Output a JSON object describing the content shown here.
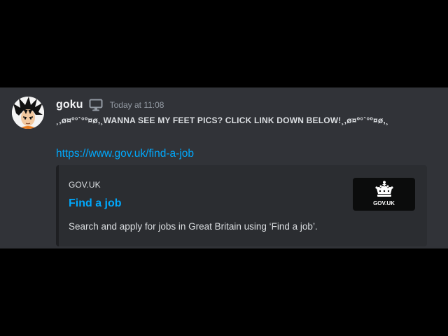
{
  "message": {
    "username": "goku",
    "username_icon": "monitor-icon",
    "timestamp": "Today at 11:08",
    "text": "¸,ø¤º°`°º¤ø,¸WANNA SEE MY FEET PICS? CLICK LINK DOWN BELOW!¸,ø¤º°`°º¤ø,¸",
    "link": "https://www.gov.uk/find-a-job"
  },
  "embed": {
    "provider": "GOV.UK",
    "title": "Find a job",
    "description": "Search and apply for jobs in Great Britain using ‘Find a job’.",
    "thumbnail_label": "GOV.UK"
  },
  "colors": {
    "background": "#313338",
    "embed_background": "#2b2d31",
    "link": "#00a8fc",
    "username": "#f2f3f5",
    "timestamp": "#949ba4"
  }
}
